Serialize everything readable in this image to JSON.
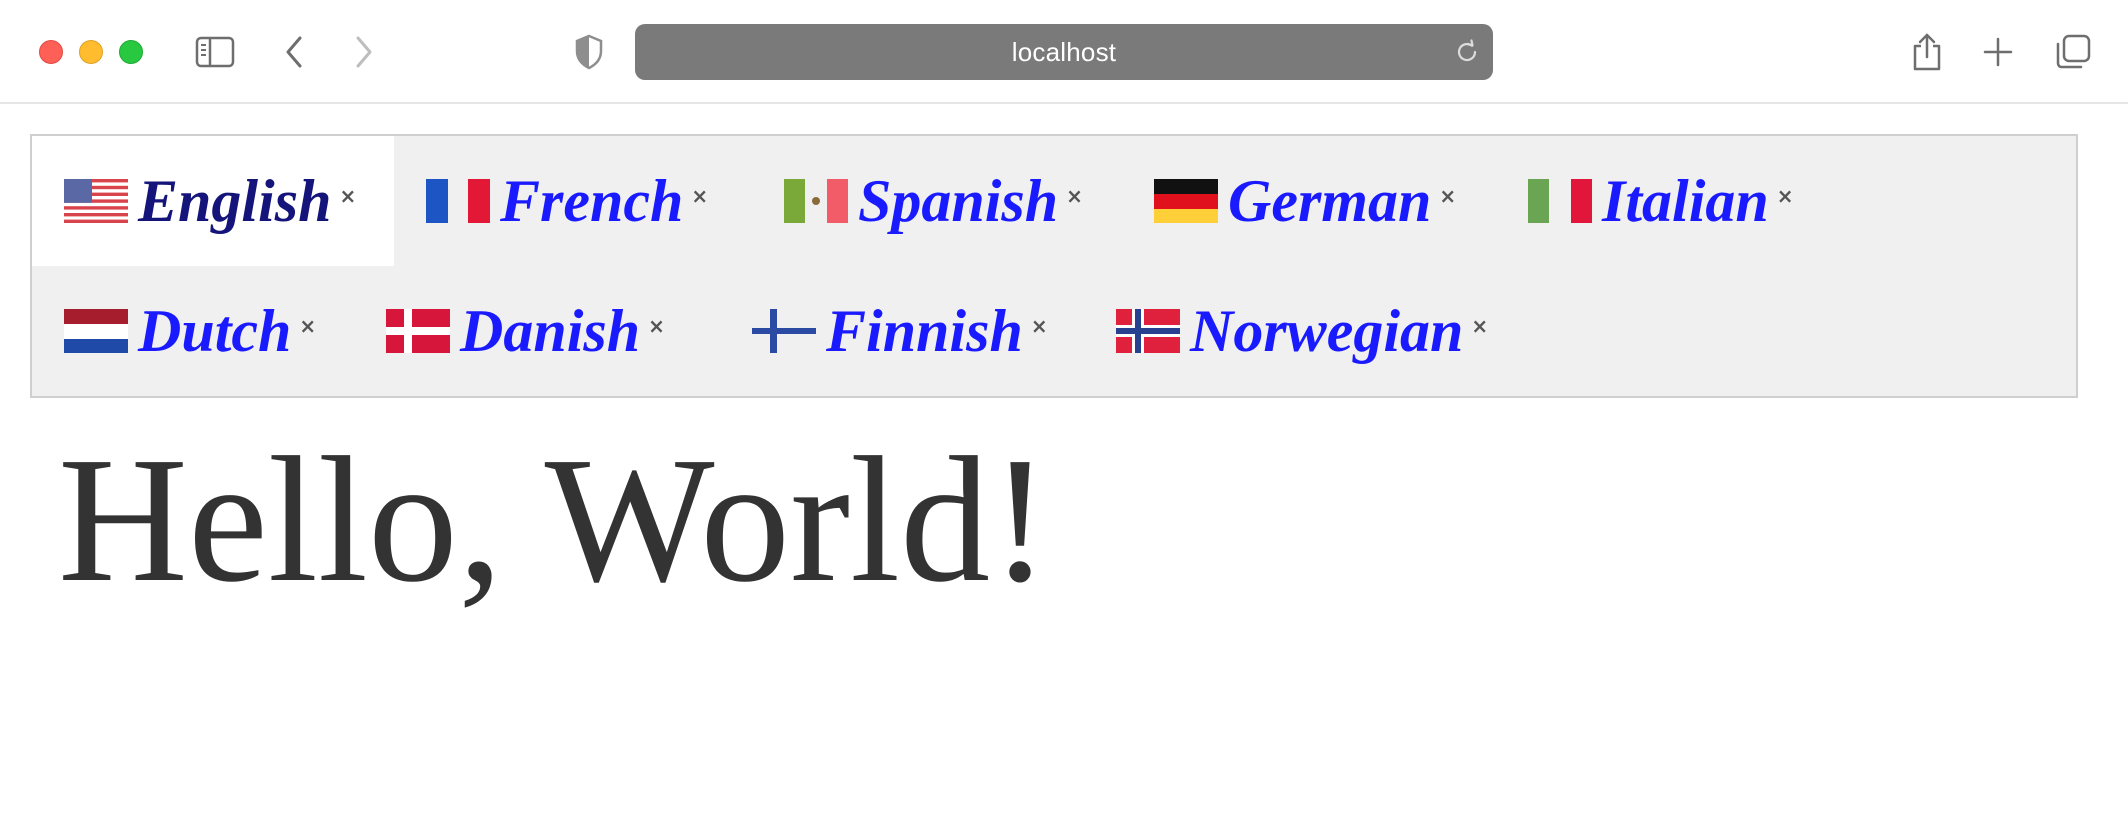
{
  "browser": {
    "url": "localhost",
    "icons": {
      "sidebar": "sidebar-icon",
      "back": "chevron-left-icon",
      "forward": "chevron-right-icon",
      "shield": "shield-icon",
      "reload": "reload-icon",
      "share": "share-icon",
      "new_tab": "plus-icon",
      "tab_overview": "tabs-icon"
    }
  },
  "tabs": [
    {
      "label": "English",
      "flag": "us-flag-icon",
      "close": "×",
      "active": true
    },
    {
      "label": "French",
      "flag": "france-flag-icon",
      "close": "×",
      "active": false
    },
    {
      "label": "Spanish",
      "flag": "mexico-flag-icon",
      "close": "×",
      "active": false
    },
    {
      "label": "German",
      "flag": "germany-flag-icon",
      "close": "×",
      "active": false
    },
    {
      "label": "Italian",
      "flag": "italy-flag-icon",
      "close": "×",
      "active": false
    },
    {
      "label": "Dutch",
      "flag": "netherlands-flag-icon",
      "close": "×",
      "active": false
    },
    {
      "label": "Danish",
      "flag": "denmark-flag-icon",
      "close": "×",
      "active": false
    },
    {
      "label": "Finnish",
      "flag": "finland-flag-icon",
      "close": "×",
      "active": false
    },
    {
      "label": "Norwegian",
      "flag": "norway-flag-icon",
      "close": "×",
      "active": false
    }
  ],
  "content": {
    "heading": "Hello, World!"
  },
  "colors": {
    "tab_text": "#1a1aff",
    "active_tab_text": "#14147a",
    "tab_bar_bg": "#f0f0f0",
    "heading_text": "#333333",
    "url_bar_bg": "#7a7a7a"
  }
}
